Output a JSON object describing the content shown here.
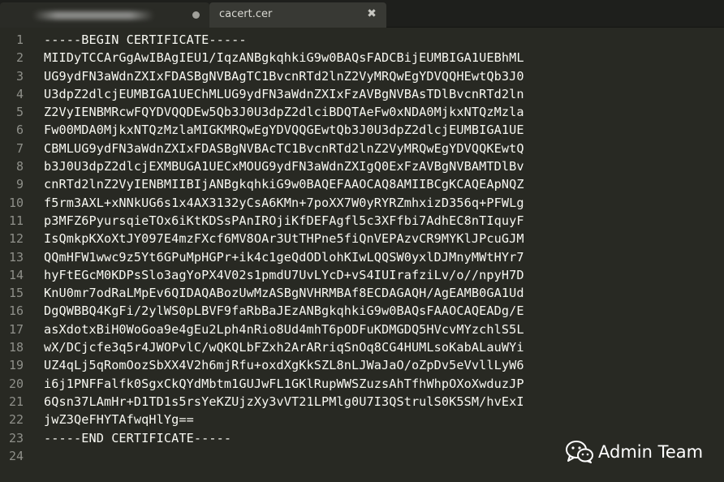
{
  "tabs": [
    {
      "label": ""
    },
    {
      "label": "cacert.cer",
      "close": "✖"
    }
  ],
  "lines": [
    "-----BEGIN CERTIFICATE-----",
    "MIIDyTCCArGgAwIBAgIEU1/IqzANBgkqhkiG9w0BAQsFADCBijEUMBIGA1UEBhML",
    "UG9ydFN3aWdnZXIxFDASBgNVBAgTC1BvcnRTd2lnZ2VyMRQwEgYDVQQHEwtQb3J0",
    "U3dpZ2dlcjEUMBIGA1UEChMLUG9ydFN3aWdnZXIxFzAVBgNVBAsTDlBvcnRTd2ln",
    "Z2VyIENBMRcwFQYDVQQDEw5Qb3J0U3dpZ2dlciBDQTAeFw0xNDA0MjkxNTQzMzla",
    "Fw00MDA0MjkxNTQzMzlaMIGKMRQwEgYDVQQGEwtQb3J0U3dpZ2dlcjEUMBIGA1UE",
    "CBMLUG9ydFN3aWdnZXIxFDASBgNVBAcTC1BvcnRTd2lnZ2VyMRQwEgYDVQQKEwtQ",
    "b3J0U3dpZ2dlcjEXMBUGA1UECxMOUG9ydFN3aWdnZXIgQ0ExFzAVBgNVBAMTDlBv",
    "cnRTd2lnZ2VyIENBMIIBIjANBgkqhkiG9w0BAQEFAAOCAQ8AMIIBCgKCAQEApNQZ",
    "f5rm3AXL+xNNkUG6s1x4AX3132yCsA6KMn+7poXX7W0yRYRZmhxizD356q+PFWLg",
    "p3MFZ6PyursqieTOx6iKtKDSsPAnIROjiKfDEFAgfl5c3XFfbi7AdhEC8nTIquyF",
    "IsQmkpKXoXtJY097E4mzFXcf6MV8OAr3UtTHPne5fiQnVEPAzvCR9MYKlJPcuGJM",
    "QQmHFW1wwc9z5Yt6GPuMpHGPr+ik4c1geQdODlohKIwLQQSW0yxlDJMnyMWtHYr7",
    "hyFtEGcM0KDPsSlo3agYoPX4V02s1pmdU7UvLYcD+vS4IUIrafziLv/o//npyH7D",
    "KnU0mr7odRaLMpEv6QIDAQABozUwMzASBgNVHRMBAf8ECDAGAQH/AgEAMB0GA1Ud",
    "DgQWBBQ4KgFi/2ylWS0pLBVF9faRbBaJEzANBgkqhkiG9w0BAQsFAAOCAQEADg/E",
    "asXdotxBiH0WoGoa9e4gEu2Lph4nRio8Ud4mhT6pODFuKDMGDQ5HVcvMYzchlS5L",
    "wX/DCjcfe3q5r4JWOPvlC/wQKQLbFZxh2ArARriqSnOq8CG4HUMLsoKabALauWYi",
    "UZ4qLj5qRomOozSbXX4V2h6mjRfu+oxdXgKkSZL8nLJWaJaO/oZpDv5eVvllLyW6",
    "i6j1PNFFalfk0SgxCkQYdMbtm1GUJwFL1GKlRupWWSZuzsAhTfhWhpOXoXwduzJP",
    "6Qsn37LAmHr+D1TD1s5rsYeKZUjzXy3vVT21LPMlg0U7I3QStrulS0K5SM/hvExI",
    "jwZ3QeFHYTAfwqHlYg==",
    "-----END CERTIFICATE-----",
    ""
  ],
  "line_numbers": [
    "1",
    "2",
    "3",
    "4",
    "5",
    "6",
    "7",
    "8",
    "9",
    "10",
    "11",
    "12",
    "13",
    "14",
    "15",
    "16",
    "17",
    "18",
    "19",
    "20",
    "21",
    "22",
    "23",
    "24"
  ],
  "watermark": {
    "text": "Admin Team",
    "icon": "wechat-icon"
  },
  "colors": {
    "background": "#282923",
    "text": "#f8f8f2",
    "gutter": "#8f908a",
    "active_tab": "#383934"
  }
}
